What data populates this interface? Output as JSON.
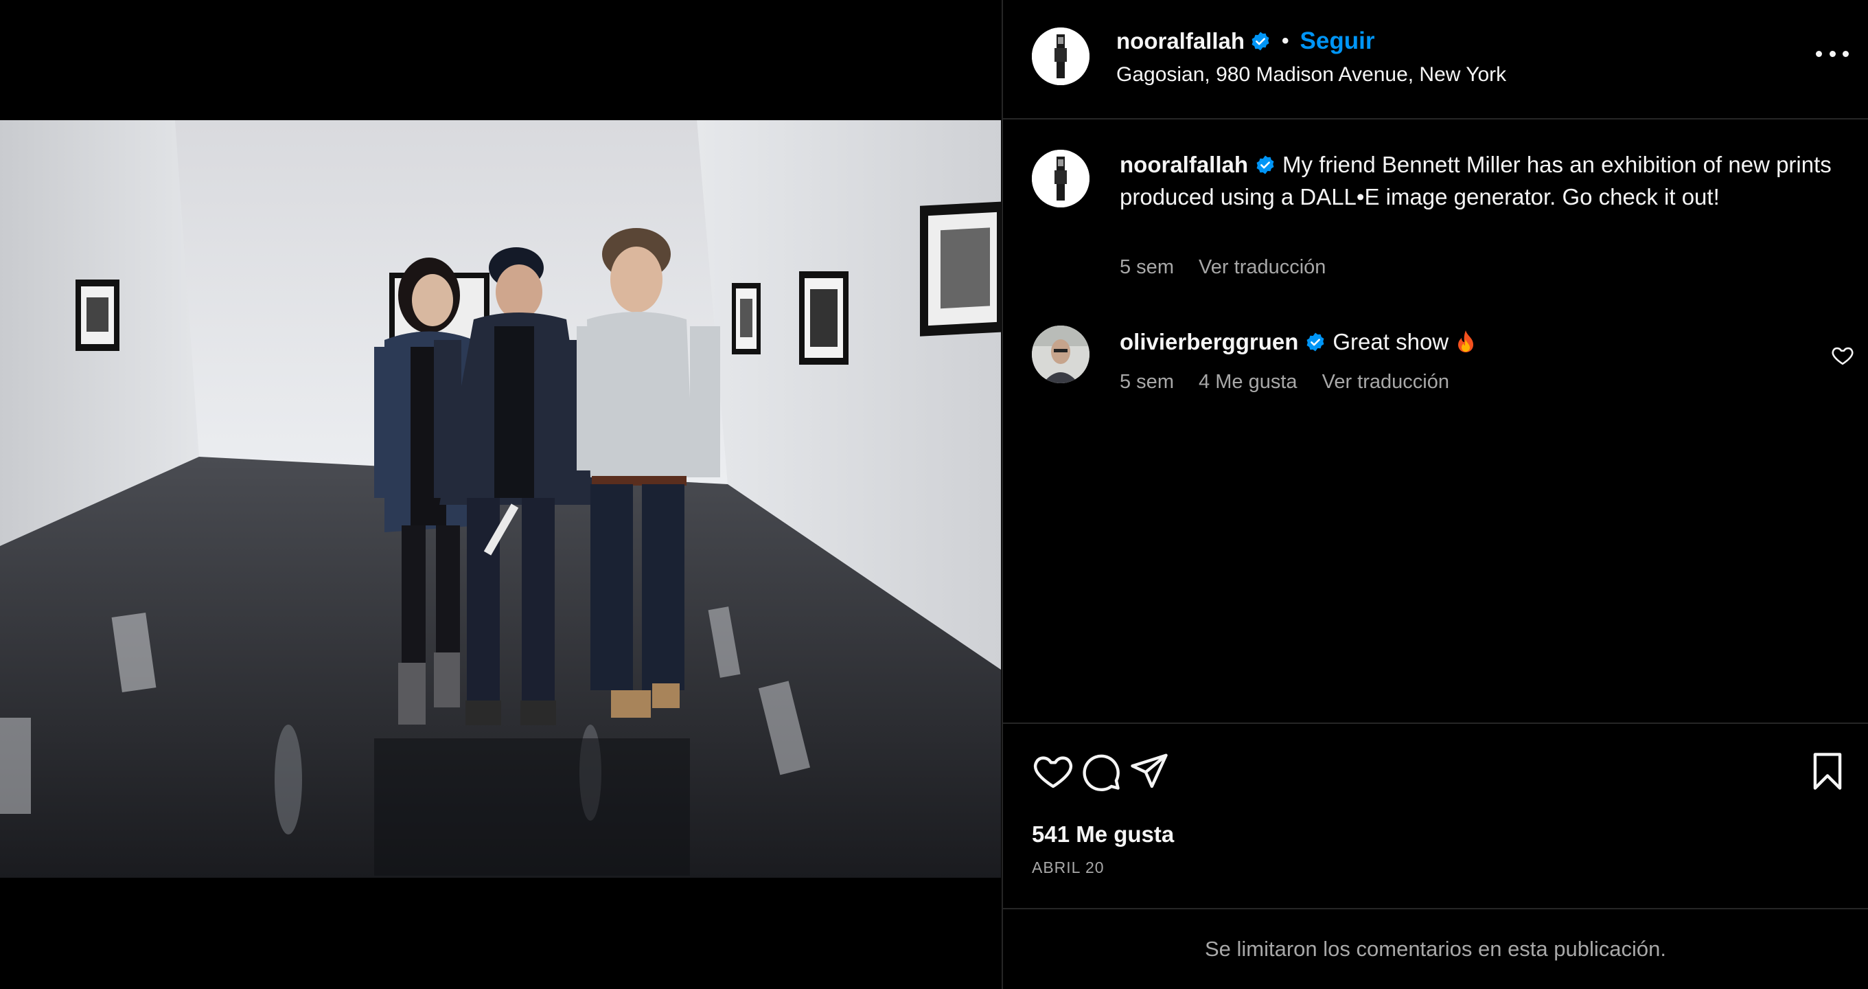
{
  "post": {
    "author": "nooralfallah",
    "follow_label": "Seguir",
    "separator": "•",
    "location": "Gagosian, 980 Madison Avenue, New York"
  },
  "caption": {
    "author": "nooralfallah",
    "text": "My friend Bennett Miller has an exhibition of new prints produced using a DALL•E image generator. Go check it out!",
    "time": "5 sem",
    "translate": "Ver traducción"
  },
  "comment": {
    "author": "olivierberggruen",
    "text": "Great show",
    "emoji": "fire",
    "time": "5 sem",
    "likes": "4 Me gusta",
    "translate": "Ver traducción"
  },
  "actions": {
    "likes": "541 Me gusta",
    "date": "ABRIL 20"
  },
  "footer": {
    "notice": "Se limitaron los comentarios en esta publicación."
  },
  "colors": {
    "background": "#000000",
    "link_blue": "#0095f6",
    "verified_blue": "#0095f6",
    "muted_text": "#a8a8a8",
    "divider": "#262626"
  },
  "icons": [
    "verified-badge-icon",
    "more-options-icon",
    "heart-icon",
    "comment-icon",
    "share-icon",
    "bookmark-icon",
    "fire-emoji"
  ]
}
